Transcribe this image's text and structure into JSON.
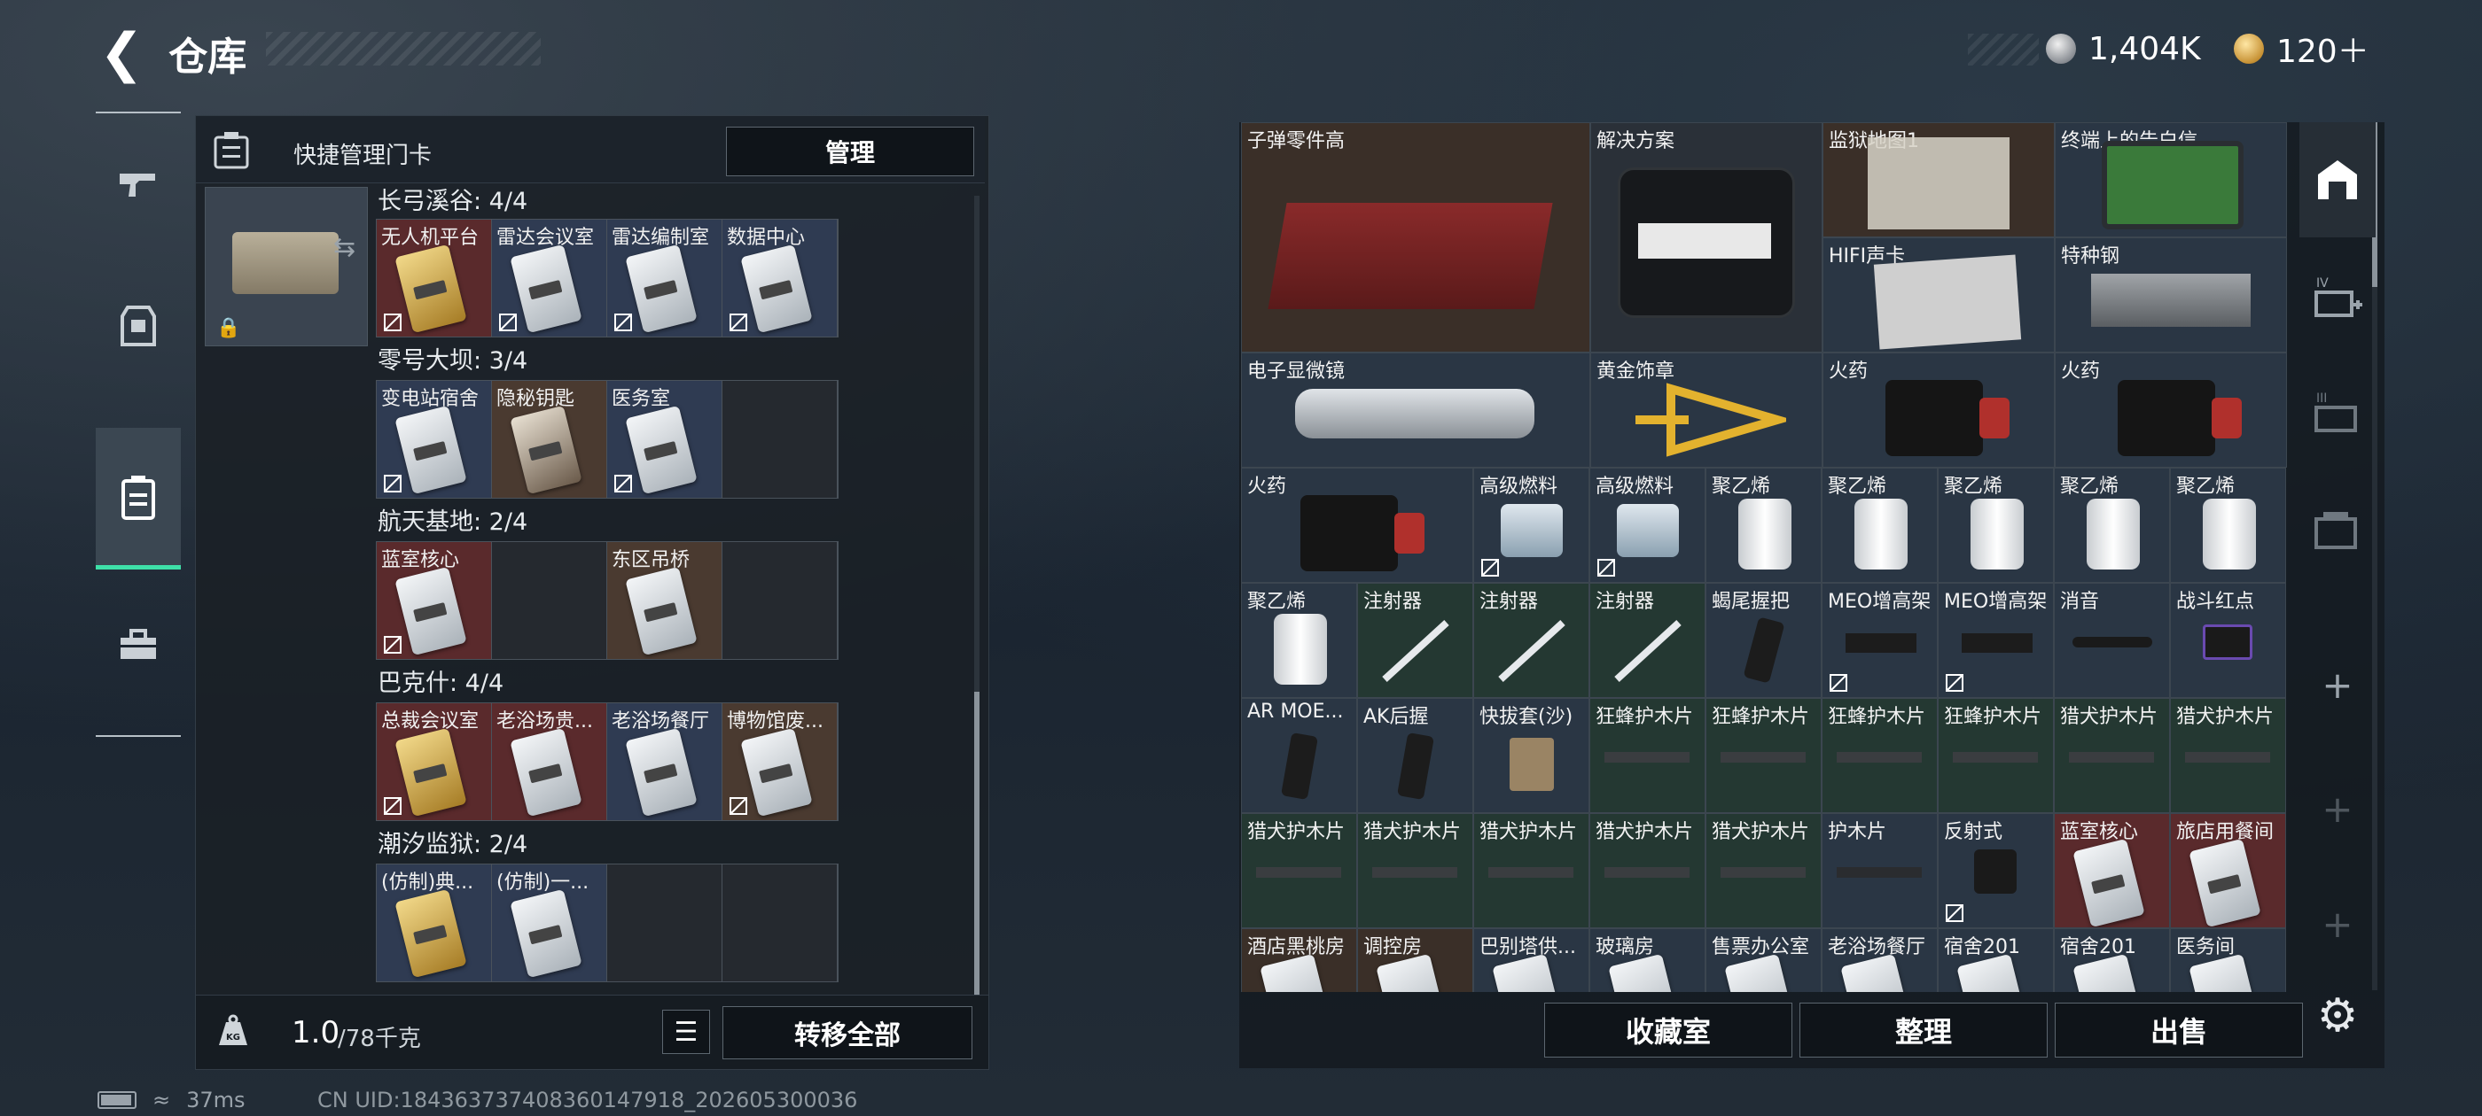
{
  "header": {
    "title": "仓库",
    "silver_amount": "1,404K",
    "gold_amount": "120＋"
  },
  "left_panel": {
    "header_label": "快捷管理门卡",
    "manage_label": "管理",
    "regions": [
      {
        "title": "长弓溪谷: 4/4",
        "slots": [
          "无人机平台",
          "雷达会议室",
          "雷达编制室",
          "数据中心"
        ]
      },
      {
        "title": "零号大坝: 3/4",
        "slots": [
          "变电站宿舍",
          "隐秘钥匙",
          "医务室",
          ""
        ]
      },
      {
        "title": "航天基地: 2/4",
        "slots": [
          "蓝室核心",
          "",
          "东区吊桥",
          ""
        ]
      },
      {
        "title": "巴克什: 4/4",
        "slots": [
          "总裁会议室",
          "老浴场贵...",
          "老浴场餐厅",
          "博物馆废..."
        ]
      },
      {
        "title": "潮汐监狱: 2/4",
        "slots": [
          "(仿制)典...",
          "(仿制)一...",
          "",
          ""
        ]
      }
    ],
    "weight": "1.0",
    "weight_max": "/78千克",
    "transfer_all_label": "转移全部"
  },
  "grid_items": [
    "子弹零件高",
    "解决方案",
    "监狱地图1",
    "终端上的告白信",
    "HIFI声卡",
    "特种钢",
    "电子显微镜",
    "黄金饰章",
    "火药",
    "火药",
    "火药",
    "高级燃料",
    "高级燃料",
    "聚乙烯",
    "聚乙烯",
    "聚乙烯",
    "聚乙烯",
    "聚乙烯",
    "聚乙烯",
    "注射器",
    "注射器",
    "注射器",
    "蝎尾握把",
    "MEO增高架",
    "MEO增高架",
    "消音",
    "战斗红点",
    "AR MOE...",
    "AK后握",
    "快拔套(沙)",
    "狂蜂护木片",
    "狂蜂护木片",
    "狂蜂护木片",
    "狂蜂护木片",
    "猎犬护木片",
    "猎犬护木片",
    "猎犬护木片",
    "猎犬护木片",
    "猎犬护木片",
    "猎犬护木片",
    "猎犬护木片",
    "护木片",
    "反射式",
    "蓝室核心",
    "旅店用餐间",
    "酒店黑桃房",
    "调控房",
    "巴别塔供...",
    "玻璃房",
    "售票办公室",
    "老浴场餐厅",
    "宿舍201",
    "宿舍201",
    "医务间"
  ],
  "right_footer": {
    "collection_label": "收藏室",
    "sort_label": "整理",
    "sell_label": "出售"
  },
  "status_bar": {
    "ping": "37ms",
    "uid": "CN UID:184363737408360147918_202605300036"
  },
  "colors": {
    "accent": "#3ee0a8",
    "panel_bg": "#1a2026",
    "slot_red": "#5a2a2c",
    "slot_blue": "#2f3b52"
  }
}
